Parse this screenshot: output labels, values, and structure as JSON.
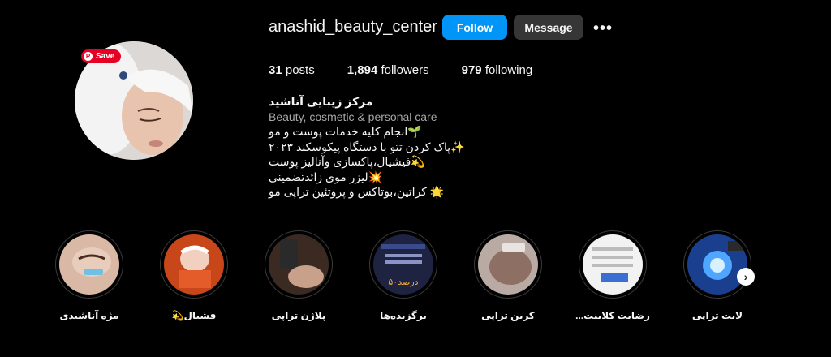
{
  "profile": {
    "username": "anashid_beauty_center",
    "follow_label": "Follow",
    "message_label": "Message",
    "more_label": "•••"
  },
  "avatar": {
    "save_label": "Save",
    "pin_glyph": "P"
  },
  "stats": {
    "posts_count": "31",
    "posts_label": "posts",
    "followers_count": "1,894",
    "followers_label": "followers",
    "following_count": "979",
    "following_label": "following"
  },
  "bio": {
    "name": "مرکز زیبایی آناشید",
    "category": "Beauty, cosmetic & personal care",
    "lines": [
      "🌱انجام کلیه خدمات پوست و مو",
      "✨پاک کردن تتو با دستگاه پیکوسکند ۲۰۲۳",
      "💫فیشیال،پاکسازی وآنالیز پوست",
      "💥لیزر موی زائدتضمینی",
      "🌟 کراتین،بوتاکس و پروتئین تراپی مو"
    ]
  },
  "highlights": [
    {
      "label": "مژه آناشیدی"
    },
    {
      "label": "فشیال💫"
    },
    {
      "label": "پلاژن تراپی"
    },
    {
      "label": "برگزیده‌ها"
    },
    {
      "label": "کربن تراپی"
    },
    {
      "label": "رضایت کلاینت..."
    },
    {
      "label": "لایت تراپی"
    }
  ],
  "highlight_thumb_text": {
    "h3_price": "۵۰درصد"
  },
  "next_arrow": "›",
  "colors": {
    "background": "#000000",
    "follow": "#0095f6",
    "message": "#363636",
    "save": "#e60023"
  }
}
